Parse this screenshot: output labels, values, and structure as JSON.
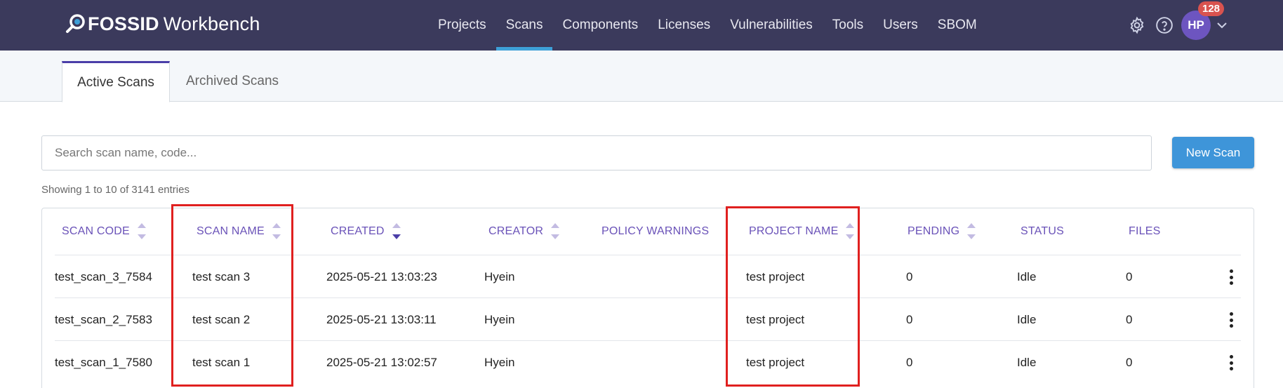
{
  "brand": {
    "fossid": "FOSS",
    "id": "ID",
    "workbench": "Workbench"
  },
  "nav": [
    {
      "label": "Projects",
      "active": false
    },
    {
      "label": "Scans",
      "active": true
    },
    {
      "label": "Components",
      "active": false
    },
    {
      "label": "Licenses",
      "active": false
    },
    {
      "label": "Vulnerabilities",
      "active": false
    },
    {
      "label": "Tools",
      "active": false
    },
    {
      "label": "Users",
      "active": false
    },
    {
      "label": "SBOM",
      "active": false
    }
  ],
  "user": {
    "initials": "HP",
    "notifications": "128"
  },
  "tabs": {
    "active": "Active Scans",
    "archived": "Archived Scans"
  },
  "search": {
    "placeholder": "Search scan name, code...",
    "value": ""
  },
  "new_scan_label": "New Scan",
  "showing_text": "Showing 1 to 10 of 3141 entries",
  "columns": {
    "scan_code": "SCAN CODE",
    "scan_name": "SCAN NAME",
    "created": "CREATED",
    "creator": "CREATOR",
    "policy_warnings": "POLICY WARNINGS",
    "project_name": "PROJECT NAME",
    "pending": "PENDING",
    "status": "STATUS",
    "files": "FILES"
  },
  "rows": [
    {
      "scan_code": "test_scan_3_7584",
      "scan_name": "test scan 3",
      "created": "2025-05-21 13:03:23",
      "creator": "Hyein",
      "policy_warnings": "",
      "project_name": "test project",
      "pending": "0",
      "status": "Idle",
      "files": "0"
    },
    {
      "scan_code": "test_scan_2_7583",
      "scan_name": "test scan 2",
      "created": "2025-05-21 13:03:11",
      "creator": "Hyein",
      "policy_warnings": "",
      "project_name": "test project",
      "pending": "0",
      "status": "Idle",
      "files": "0"
    },
    {
      "scan_code": "test_scan_1_7580",
      "scan_name": "test scan 1",
      "created": "2025-05-21 13:02:57",
      "creator": "Hyein",
      "policy_warnings": "",
      "project_name": "test project",
      "pending": "0",
      "status": "Idle",
      "files": "0"
    }
  ],
  "colors": {
    "navbar": "#3b3a5c",
    "accent": "#3ea0d8",
    "header_text": "#6a52b8",
    "highlight": "#e0201f",
    "button": "#3e95d9"
  }
}
